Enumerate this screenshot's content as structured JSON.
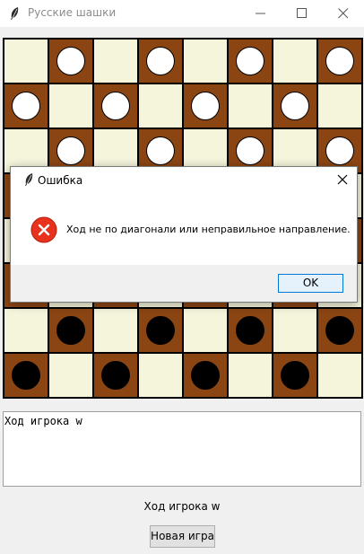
{
  "window": {
    "title": "Русские шашки",
    "icon": "feather-icon"
  },
  "board": {
    "size": 8,
    "colors": {
      "light": "#f5f5dc",
      "dark": "#8b4513",
      "white_piece": "#ffffff",
      "black_piece": "#000000"
    },
    "pieces": [
      ".w.w.w.w",
      "w.w.w.w.",
      ".w.w.w.w",
      "........",
      "........",
      "b.b.b.b.",
      ".b.b.b.b",
      "b.b.b.b."
    ]
  },
  "log": {
    "text": "Ход игрока w"
  },
  "status": {
    "text": "Ход игрока w"
  },
  "buttons": {
    "new_game": "Новая игра"
  },
  "dialog": {
    "title": "Ошибка",
    "message": "Ход не по диагонали или неправильное направление.",
    "ok_label": "OK",
    "icon": "error-icon"
  }
}
